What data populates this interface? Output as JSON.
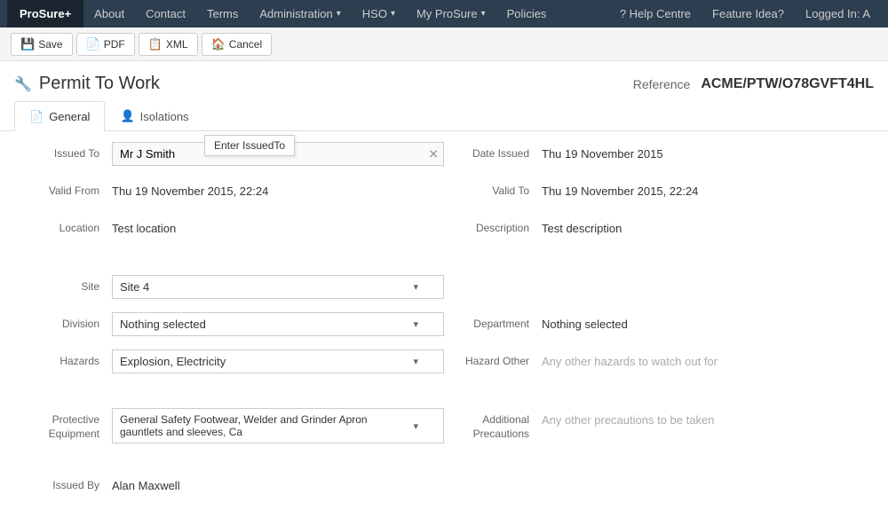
{
  "nav": {
    "brand": "ProSure+",
    "items": [
      {
        "label": "About",
        "has_caret": false
      },
      {
        "label": "Contact",
        "has_caret": false
      },
      {
        "label": "Terms",
        "has_caret": false
      },
      {
        "label": "Administration",
        "has_caret": true
      },
      {
        "label": "HSO",
        "has_caret": true
      },
      {
        "label": "My ProSure",
        "has_caret": true
      },
      {
        "label": "Policies",
        "has_caret": false
      }
    ],
    "help": "? Help Centre",
    "feature": "Feature Idea?",
    "logged_in": "Logged In: A"
  },
  "toolbar": {
    "save_label": "Save",
    "pdf_label": "PDF",
    "xml_label": "XML",
    "cancel_label": "Cancel"
  },
  "page": {
    "title": "Permit To Work",
    "reference_label": "Reference",
    "reference_value": "ACME/PTW/O78GVFT4HL"
  },
  "tabs": [
    {
      "label": "General",
      "icon": "file",
      "active": true
    },
    {
      "label": "Isolations",
      "icon": "user",
      "active": false
    }
  ],
  "tooltip": "Enter IssuedTo",
  "form": {
    "issued_to_label": "Issued To",
    "issued_to_value": "Mr J Smith",
    "issued_to_placeholder": "Enter IssuedTo",
    "date_issued_label": "Date Issued",
    "date_issued_value": "Thu 19 November 2015",
    "valid_from_label": "Valid From",
    "valid_from_value": "Thu 19 November 2015, 22:24",
    "valid_to_label": "Valid To",
    "valid_to_value": "Thu 19 November 2015, 22:24",
    "location_label": "Location",
    "location_value": "Test location",
    "description_label": "Description",
    "description_value": "Test description",
    "site_label": "Site",
    "site_value": "Site 4",
    "division_label": "Division",
    "division_value": "Nothing selected",
    "department_label": "Department",
    "department_value": "Nothing selected",
    "hazards_label": "Hazards",
    "hazards_value": "Explosion, Electricity",
    "hazard_other_label": "Hazard Other",
    "hazard_other_placeholder": "Any other hazards to watch out for",
    "protective_label": "Protective Equipment",
    "protective_value": "General Safety Footwear, Welder and Grinder Apron gauntlets and sleeves, Ca",
    "additional_label": "Additional Precautions",
    "additional_placeholder": "Any other precautions to be taken",
    "issued_by_label": "Issued By",
    "issued_by_value": "Alan Maxwell"
  }
}
